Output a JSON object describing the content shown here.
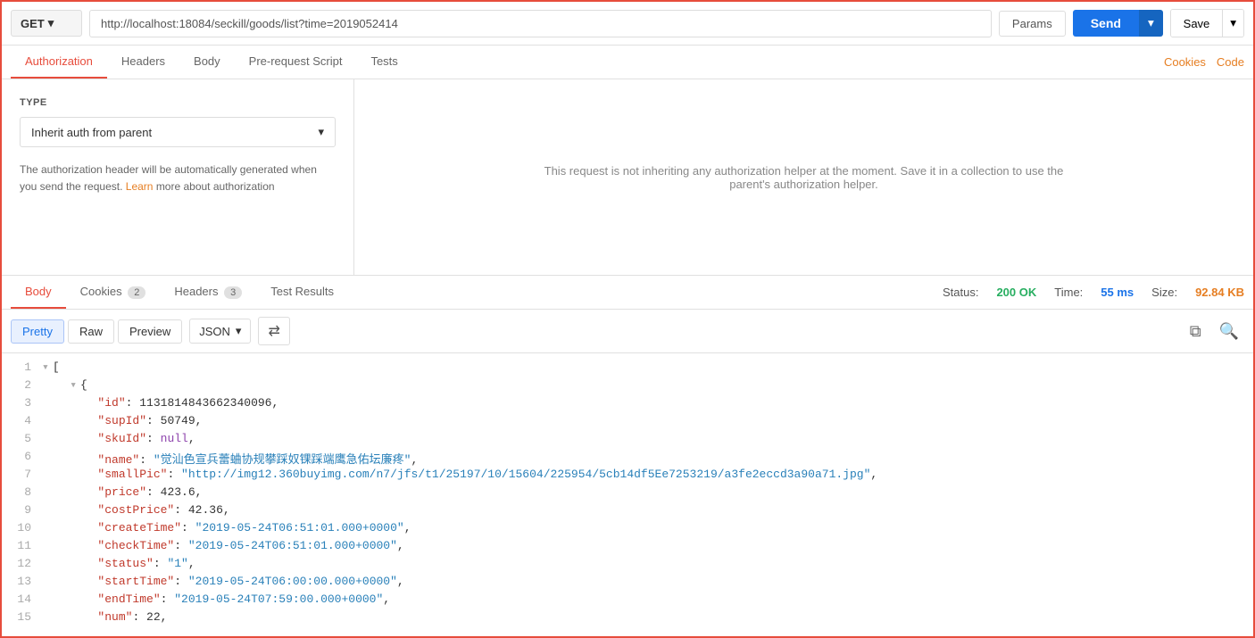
{
  "request": {
    "method": "GET",
    "url": "http://localhost:18084/seckill/goods/list?time=2019052414",
    "params_label": "Params",
    "send_label": "Send",
    "save_label": "Save"
  },
  "request_tabs": [
    {
      "label": "Authorization",
      "active": true
    },
    {
      "label": "Headers"
    },
    {
      "label": "Body"
    },
    {
      "label": "Pre-request Script"
    },
    {
      "label": "Tests"
    }
  ],
  "request_tab_right": {
    "cookies": "Cookies",
    "code": "Code"
  },
  "auth": {
    "type_label": "TYPE",
    "type_value": "Inherit auth from parent",
    "description_before": "The authorization header will be automatically generated when you send the request.",
    "learn_link": "Learn",
    "description_after": "more about authorization",
    "info_text": "This request is not inheriting any authorization helper at the moment. Save it in a collection to use the parent's authorization helper."
  },
  "response": {
    "tabs": [
      {
        "label": "Body",
        "active": true,
        "badge": null
      },
      {
        "label": "Cookies",
        "badge": "2"
      },
      {
        "label": "Headers",
        "badge": "3"
      },
      {
        "label": "Test Results",
        "badge": null
      }
    ],
    "status_label": "Status:",
    "status_value": "200 OK",
    "time_label": "Time:",
    "time_value": "55 ms",
    "size_label": "Size:",
    "size_value": "92.84 KB",
    "format_buttons": [
      "Pretty",
      "Raw",
      "Preview"
    ],
    "active_format": "Pretty",
    "json_label": "JSON",
    "wrap_icon": "≡"
  },
  "code_lines": [
    {
      "num": 1,
      "content": "[",
      "type": "bracket",
      "fold": true
    },
    {
      "num": 2,
      "content": "    {",
      "type": "bracket",
      "fold": true
    },
    {
      "num": 3,
      "content": "        \"id\": 1131814843662340096,",
      "key": "id",
      "value": "1131814843662340096",
      "vtype": "number"
    },
    {
      "num": 4,
      "content": "        \"supId\": 50749,",
      "key": "supId",
      "value": "50749",
      "vtype": "number"
    },
    {
      "num": 5,
      "content": "        \"skuId\": null,",
      "key": "skuId",
      "value": "null",
      "vtype": "null"
    },
    {
      "num": 6,
      "content": "        \"name\": \"觉汕色宣兵蕾蛐协规攀踩奴锞踩端鹰急佑坛廉疼\",",
      "key": "name",
      "vtype": "string"
    },
    {
      "num": 7,
      "content": "        \"smallPic\": \"http://img12.360buyimg.com/n7/jfs/t1/25197/10/15604/225954/5cb14df5Ee7253219/a3fe2eccd3a90a71.jpg\",",
      "key": "smallPic",
      "vtype": "string"
    },
    {
      "num": 8,
      "content": "        \"price\": 423.6,",
      "key": "price",
      "value": "423.6",
      "vtype": "number"
    },
    {
      "num": 9,
      "content": "        \"costPrice\": 42.36,",
      "key": "costPrice",
      "value": "42.36",
      "vtype": "number"
    },
    {
      "num": 10,
      "content": "        \"createTime\": \"2019-05-24T06:51:01.000+0000\",",
      "key": "createTime",
      "vtype": "string"
    },
    {
      "num": 11,
      "content": "        \"checkTime\": \"2019-05-24T06:51:01.000+0000\",",
      "key": "checkTime",
      "vtype": "string"
    },
    {
      "num": 12,
      "content": "        \"status\": \"1\",",
      "key": "status",
      "vtype": "string"
    },
    {
      "num": 13,
      "content": "        \"startTime\": \"2019-05-24T06:00:00.000+0000\",",
      "key": "startTime",
      "vtype": "string"
    },
    {
      "num": 14,
      "content": "        \"endTime\": \"2019-05-24T07:59:00.000+0000\",",
      "key": "endTime",
      "vtype": "string"
    },
    {
      "num": 15,
      "content": "        \"num\": 22,",
      "key": "num",
      "value": "22",
      "vtype": "number"
    }
  ]
}
